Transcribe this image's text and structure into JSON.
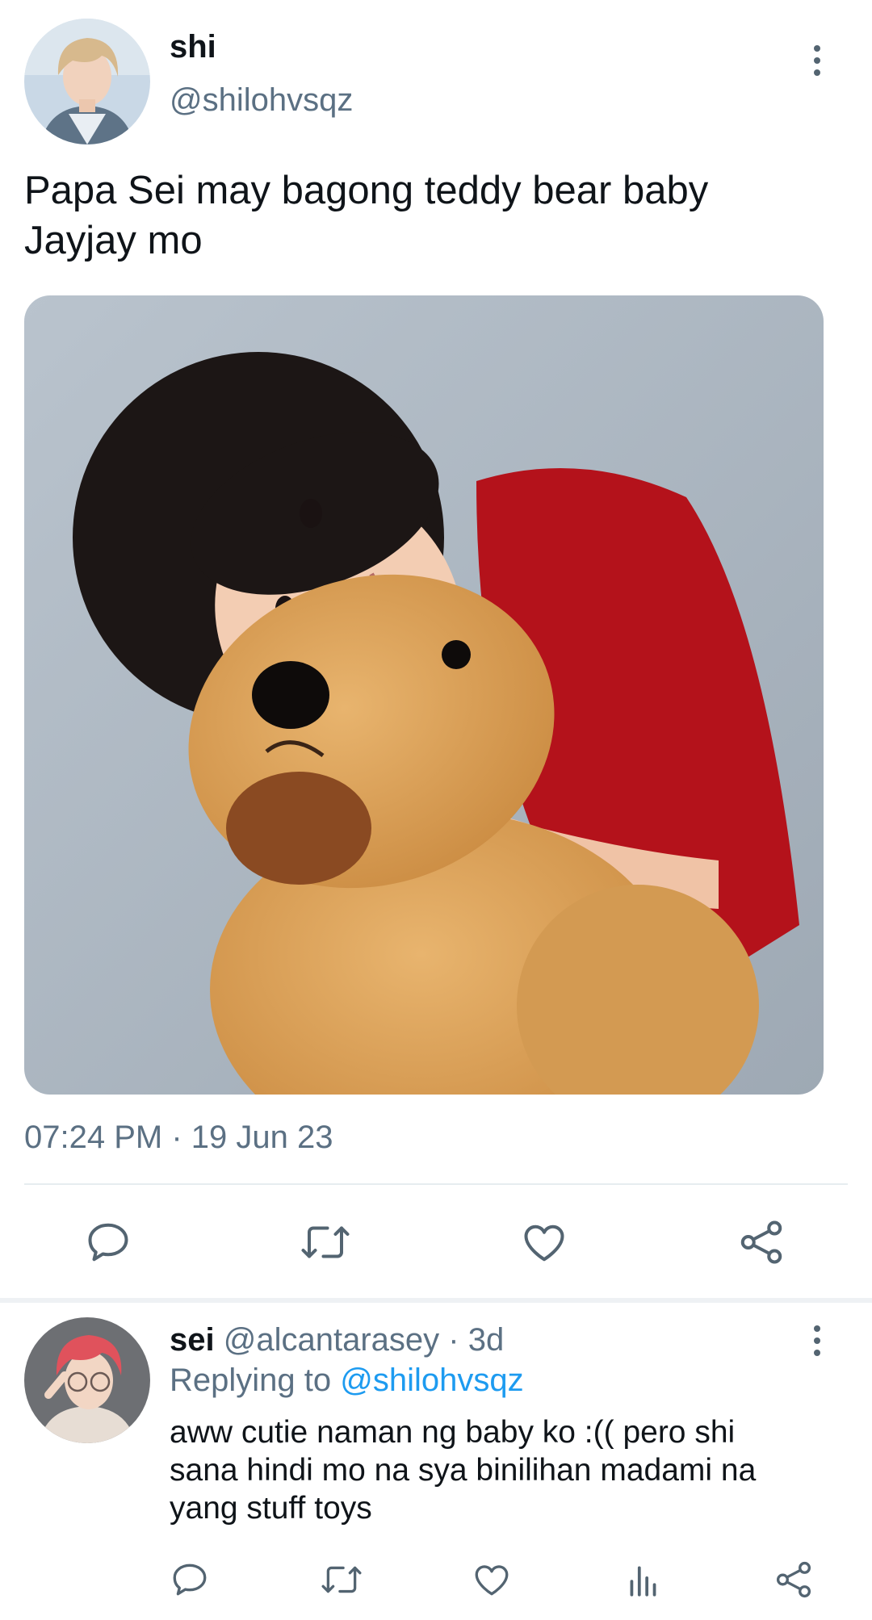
{
  "tweet": {
    "author_name": "shi",
    "author_handle": "@shilohvsqz",
    "text_line1": "Papa Sei may bagong teddy bear baby",
    "text_line2": "Jayjay mo",
    "timestamp": "07:24 PM · 19 Jun 23"
  },
  "reply": {
    "author_name": "sei",
    "author_handle": "@alcantarasey",
    "age": "· 3d",
    "replying_prefix": "Replying to",
    "replying_handle": "@shilohvsqz",
    "text_line1": "aww cutie naman ng baby ko :(( pero shi",
    "text_line2": "sana hindi mo na sya binilihan madami na",
    "text_line3": "yang stuff toys"
  },
  "icons": {
    "reply": "speech-bubble",
    "retweet": "retweet-arrows",
    "like": "heart",
    "share": "share-nodes",
    "analytics": "bar-chart",
    "more": "vertical-ellipsis"
  },
  "colors": {
    "text": "#0f1419",
    "muted": "#5b7083",
    "link": "#1d9bf0",
    "icon": "#536471",
    "divider": "#e6ecf0"
  }
}
